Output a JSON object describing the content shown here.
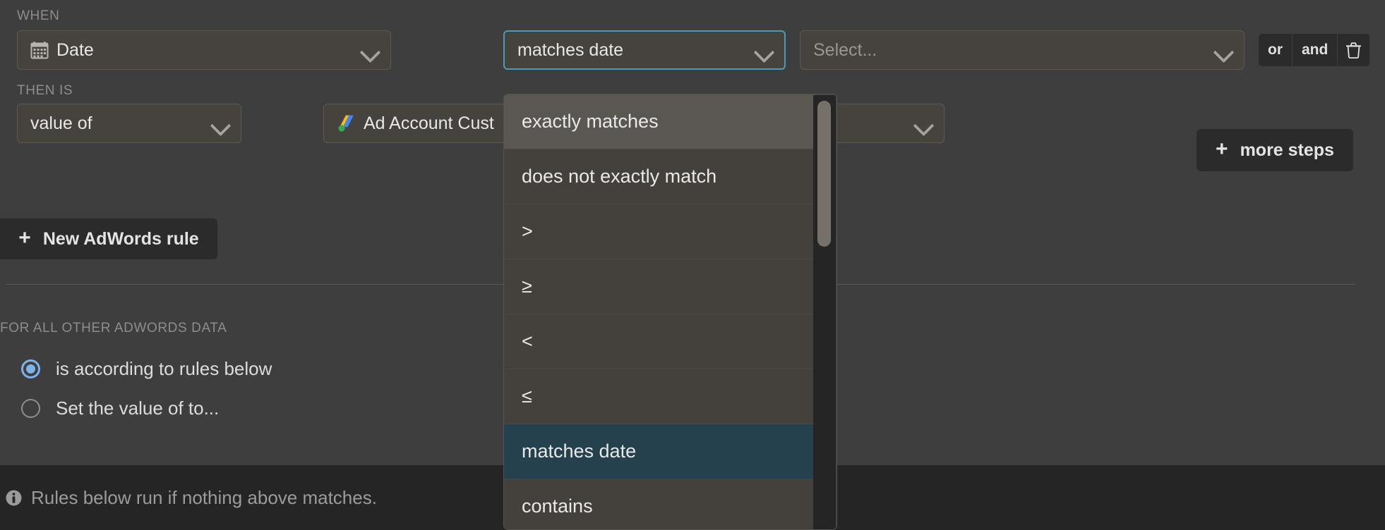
{
  "when": {
    "label": "WHEN",
    "dimension_field": {
      "icon": "calendar-icon",
      "value": "Date"
    },
    "operator_field": {
      "value": "matches date",
      "focused": true
    },
    "value_field": {
      "placeholder": "Select..."
    },
    "logic": {
      "or": "or",
      "and": "and",
      "delete_icon": "trash-icon"
    }
  },
  "then_is": {
    "label": "THEN IS",
    "mode_field": {
      "value": "value of"
    },
    "source_field": {
      "icon": "google-ads-icon",
      "value": "Ad Account Cust"
    },
    "more_steps_button": {
      "icon": "plus-icon",
      "label": "more steps"
    }
  },
  "new_rule_button": {
    "icon": "plus-icon",
    "label": "New AdWords rule"
  },
  "other_data": {
    "label": "FOR ALL OTHER ADWORDS DATA",
    "options": [
      {
        "label": "is according to rules below",
        "checked": true
      },
      {
        "label": "Set the value of to...",
        "checked": false
      }
    ]
  },
  "bottom_bar": {
    "icon": "info-icon",
    "text": "Rules below run if nothing above matches."
  },
  "operator_dropdown": {
    "open": true,
    "selected_value": "matches date",
    "hovered_value": "exactly matches",
    "items": [
      {
        "label": "exactly matches",
        "state": "hover"
      },
      {
        "label": "does not exactly match",
        "state": "normal"
      },
      {
        "label": ">",
        "state": "normal"
      },
      {
        "label": "≥",
        "state": "normal"
      },
      {
        "label": "<",
        "state": "normal"
      },
      {
        "label": "≤",
        "state": "normal"
      },
      {
        "label": "matches date",
        "state": "selected"
      },
      {
        "label": "contains",
        "state": "normal"
      }
    ]
  },
  "colors": {
    "background": "#3e3e3e",
    "field_background": "#46433e",
    "focus_ring": "#4a9cb5",
    "selection": "#24414d",
    "hover": "#5a5651",
    "radio_accent": "#7db3ea",
    "bottom_bar": "#252525",
    "button_dark": "#2b2b2b"
  }
}
